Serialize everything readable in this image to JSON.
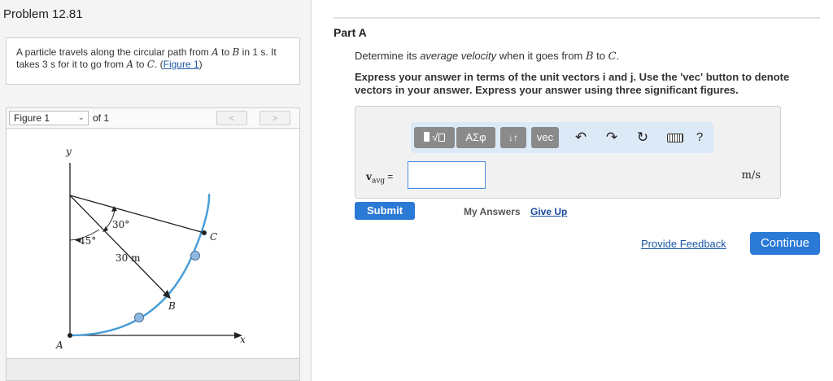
{
  "problem": {
    "title": "Problem 12.81",
    "statement_part1": "A particle travels along the circular path from ",
    "point_a": "A",
    "to_1": " to ",
    "point_b": "B",
    "statement_part2": " in 1 s. It takes 3 s for it to go from ",
    "point_a2": "A",
    "to_2": " to ",
    "point_c": "C",
    "statement_part3": ". (",
    "figure_link": "Figure 1",
    "statement_end": ")"
  },
  "figure_nav": {
    "selected": "Figure 1",
    "of_label": "of 1",
    "prev": "<",
    "next": ">"
  },
  "figure": {
    "labels": {
      "y": "y",
      "x": "x",
      "a": "A",
      "b": "B",
      "c": "C",
      "angle_30": "30°",
      "angle_45": "45°",
      "radius": "30 m"
    },
    "colors": {
      "path": "#4a9fd8",
      "particle": "#8fb9e3",
      "lines": "#222222"
    }
  },
  "part": {
    "label": "Part A",
    "determine_pre": "Determine its ",
    "determine_em": "average velocity",
    "determine_mid": " when it goes from ",
    "from_point": "B",
    "determine_to": " to ",
    "to_point": "C",
    "determine_end": ".",
    "instructions": "Express your answer in terms of the unit vectors i and j. Use the 'vec' button to denote vectors in your answer. Express your answer using three significant figures."
  },
  "toolbar": {
    "template_icon": "templates-icon",
    "greek_label": "ΑΣφ",
    "arrows_label": "↓↑",
    "vec_label": "vec",
    "undo_icon": "undo-icon",
    "redo_icon": "redo-icon",
    "reset_icon": "reset-icon",
    "keyboard_icon": "keyboard-icon",
    "help_label": "?"
  },
  "answer": {
    "variable": "v",
    "subscript": "avg",
    "equals": "=",
    "value": "",
    "units": "m/s"
  },
  "actions": {
    "submit": "Submit",
    "my_answers": "My Answers",
    "give_up": "Give Up",
    "feedback": "Provide Feedback",
    "continue": "Continue"
  },
  "colors": {
    "accent": "#2b7ad6",
    "link": "#1a57a5",
    "toolbar_bg": "#dce9f7"
  }
}
